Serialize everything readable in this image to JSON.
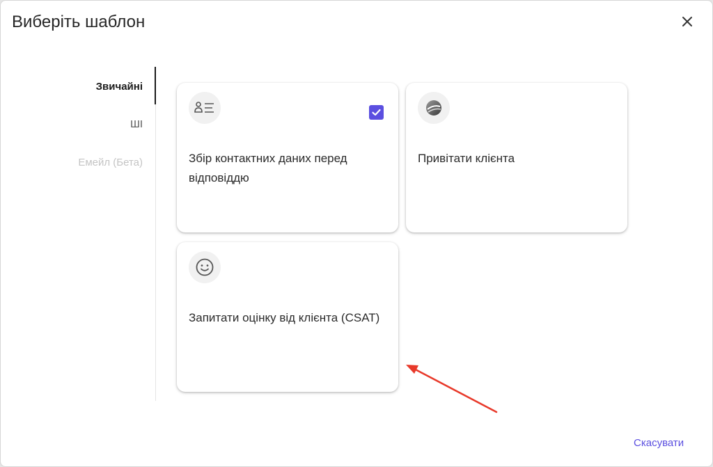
{
  "dialog": {
    "title": "Виберіть шаблон",
    "close_icon": "close-icon",
    "cancel_label": "Скасувати"
  },
  "tabs": [
    {
      "label": "Звичайні",
      "state": "active"
    },
    {
      "label": "ШІ",
      "state": "normal"
    },
    {
      "label": "Емейл (Бета)",
      "state": "disabled"
    }
  ],
  "templates": [
    {
      "title": "Збір контактних даних перед відповіддю",
      "icon": "contact-form-icon",
      "selected": true
    },
    {
      "title": "Привітати клієнта",
      "icon": "greeting-logo-icon",
      "selected": false
    },
    {
      "title": "Запитати оцінку від клієнта (CSAT)",
      "icon": "smiley-icon",
      "selected": false
    }
  ],
  "colors": {
    "accent": "#5b4fe0",
    "annotation_arrow": "#e8392a"
  }
}
